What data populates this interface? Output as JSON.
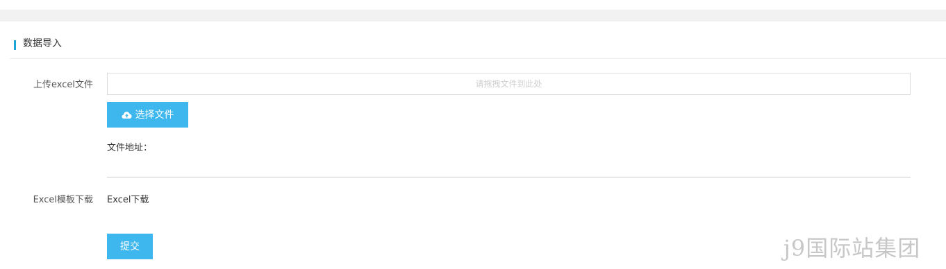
{
  "section": {
    "title": "数据导入"
  },
  "upload": {
    "label": "上传excel文件",
    "drop_zone_text": "请拖拽文件到此处",
    "choose_button_label": "选择文件",
    "file_address_label": "文件地址："
  },
  "template": {
    "label": "Excel模板下载",
    "link_text": "Excel下载"
  },
  "actions": {
    "submit_label": "提交"
  },
  "watermark": {
    "text": "j9国际站集团"
  },
  "colors": {
    "accent": "#1ea4d6",
    "button": "#3db7ee"
  }
}
